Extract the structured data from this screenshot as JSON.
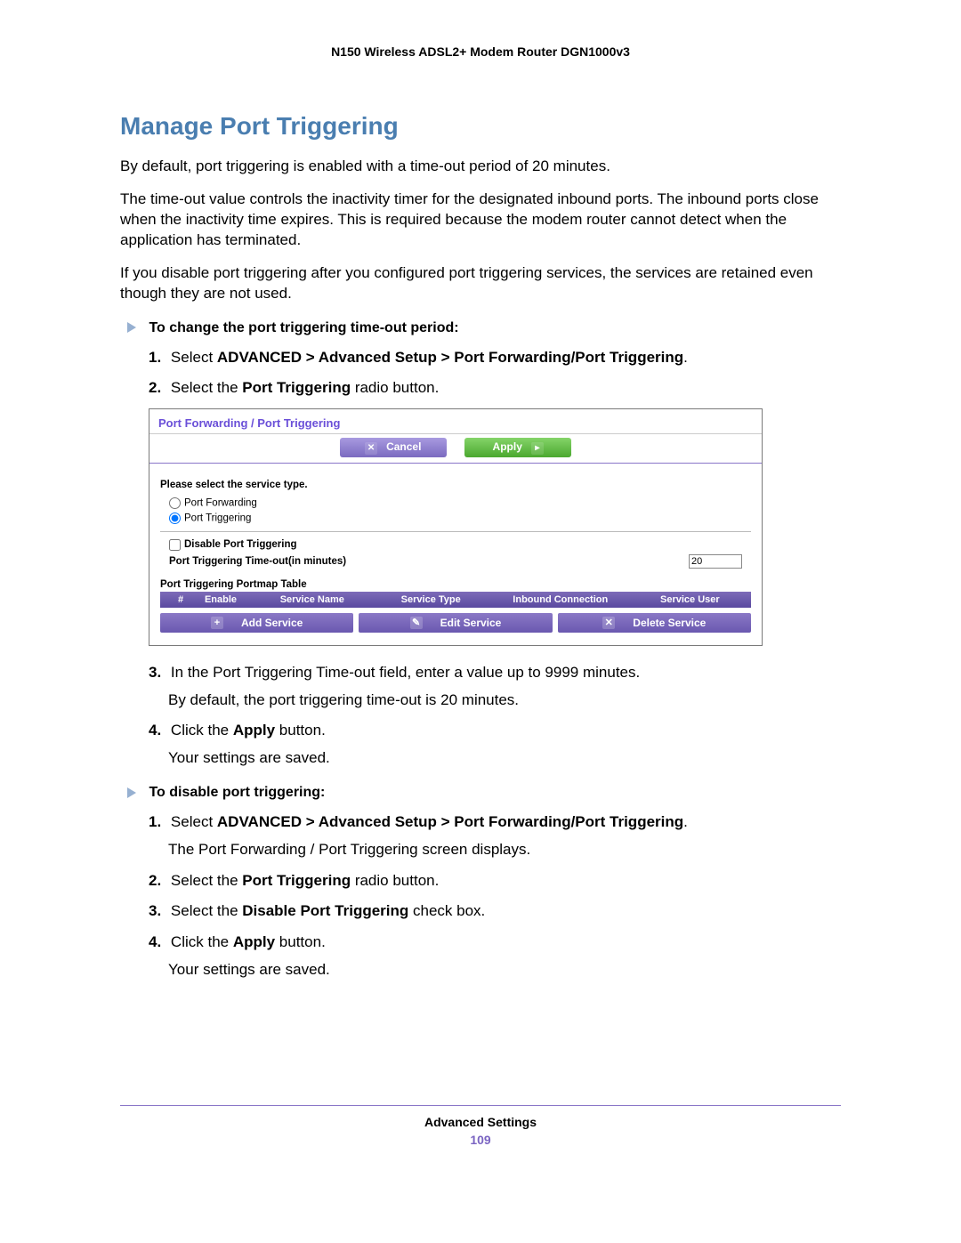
{
  "header": {
    "title": "N150 Wireless ADSL2+ Modem Router DGN1000v3"
  },
  "heading": "Manage Port Triggering",
  "intro": [
    "By default, port triggering is enabled with a time-out period of 20 minutes.",
    "The time-out value controls the inactivity timer for the designated inbound ports. The inbound ports close when the inactivity time expires. This is required because the modem router cannot detect when the application has terminated.",
    "If you disable port triggering after you configured port triggering services, the services are retained even though they are not used."
  ],
  "procA": {
    "title": "To change the port triggering time-out period:",
    "steps": {
      "s1_pre": "Select ",
      "s1_bold": "ADVANCED > Advanced Setup > Port Forwarding/Port Triggering",
      "s1_post": ".",
      "s2_pre": "Select the ",
      "s2_bold": "Port Triggering",
      "s2_post": " radio button.",
      "s3": "In the Port Triggering Time-out field, enter a value up to 9999 minutes.",
      "s3_sub": "By default, the port triggering time-out is 20 minutes.",
      "s4_pre": "Click the ",
      "s4_bold": "Apply",
      "s4_post": " button.",
      "s4_sub": "Your settings are saved."
    }
  },
  "panel": {
    "title": "Port Forwarding / Port Triggering",
    "cancel": "Cancel",
    "apply": "Apply",
    "select_label": "Please select the service type.",
    "radio_fwd": "Port Forwarding",
    "radio_trg": "Port Triggering",
    "disable_label": "Disable Port Triggering",
    "timeout_label": "Port Triggering Time-out(in minutes)",
    "timeout_value": "20",
    "table_label": "Port Triggering Portmap Table",
    "cols": {
      "c1": "#",
      "c2": "Enable",
      "c3": "Service Name",
      "c4": "Service Type",
      "c5": "Inbound Connection",
      "c6": "Service User"
    },
    "btn_add": "Add Service",
    "btn_edit": "Edit Service",
    "btn_del": "Delete Service"
  },
  "procB": {
    "title": "To disable port triggering:",
    "steps": {
      "s1_pre": "Select ",
      "s1_bold": "ADVANCED > Advanced Setup > Port Forwarding/Port Triggering",
      "s1_post": ".",
      "s1_sub": "The Port Forwarding / Port Triggering screen displays.",
      "s2_pre": "Select the ",
      "s2_bold": "Port Triggering",
      "s2_post": " radio button.",
      "s3_pre": "Select the ",
      "s3_bold": "Disable Port Triggering",
      "s3_post": " check box.",
      "s4_pre": "Click the ",
      "s4_bold": "Apply",
      "s4_post": " button.",
      "s4_sub": "Your settings are saved."
    }
  },
  "footer": {
    "label": "Advanced Settings",
    "page": "109"
  }
}
